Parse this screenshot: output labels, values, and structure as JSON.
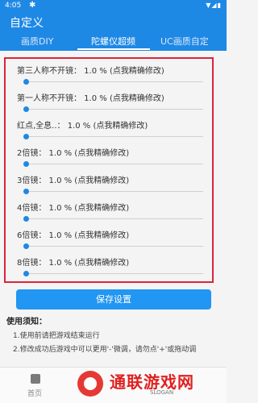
{
  "status_bar": {
    "time": "4:05",
    "notif_icon": "bug-icon"
  },
  "app": {
    "title": "自定义"
  },
  "tabs": [
    {
      "label": "画质DIY"
    },
    {
      "label": "陀螺仪超频"
    },
    {
      "label": "UC画质自定"
    }
  ],
  "settings": [
    {
      "label": "第三人称不开镜：  1.0 %  (点我精确修改)",
      "value_percent": 1.0
    },
    {
      "label": "第一人称不开镜：  1.0 %  (点我精确修改)",
      "value_percent": 1.0
    },
    {
      "label": "红点,全息..：  1.0 %  (点我精确修改)",
      "value_percent": 1.0
    },
    {
      "label": "2倍镜：  1.0 %  (点我精确修改)",
      "value_percent": 1.0
    },
    {
      "label": "3倍镜：  1.0 %  (点我精确修改)",
      "value_percent": 1.0
    },
    {
      "label": "4倍镜：  1.0 %  (点我精确修改)",
      "value_percent": 1.0
    },
    {
      "label": "6倍镜：  1.0 %  (点我精确修改)",
      "value_percent": 1.0
    },
    {
      "label": "8倍镜：  1.0 %  (点我精确修改)",
      "value_percent": 1.0
    }
  ],
  "save_button": {
    "label": "保存设置"
  },
  "notes": {
    "heading": "使用须知：",
    "lines": [
      "1.使用前请把游戏结束运行",
      "2.修改成功后游戏中可以更用'-'微调，请勿点'+'或拖动调"
    ]
  },
  "bottom_nav": {
    "home_label": "首页"
  },
  "watermark": {
    "name": "通联游戏网",
    "slogan": "SLOGAN"
  },
  "colors": {
    "accent": "#1e88e5",
    "highlight_border": "#d9253b"
  }
}
